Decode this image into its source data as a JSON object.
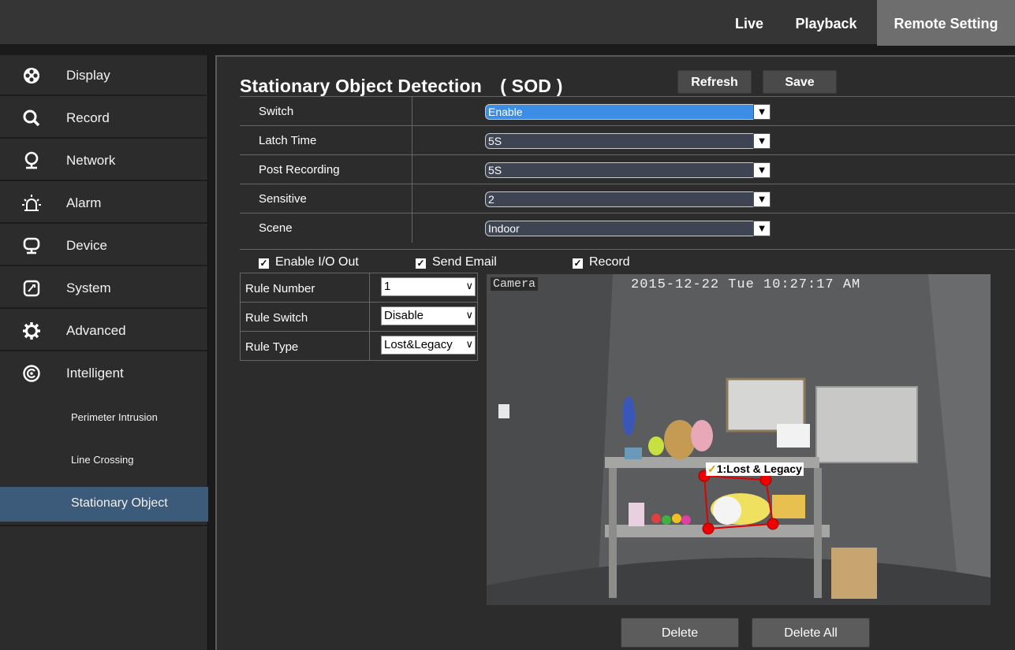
{
  "topnav": {
    "live": "Live",
    "playback": "Playback",
    "remote_setting": "Remote Setting"
  },
  "sidebar": {
    "items": [
      {
        "label": "Display",
        "icon": "display-icon"
      },
      {
        "label": "Record",
        "icon": "magnifier-icon"
      },
      {
        "label": "Network",
        "icon": "network-pin-icon"
      },
      {
        "label": "Alarm",
        "icon": "alarm-bell-icon"
      },
      {
        "label": "Device",
        "icon": "monitor-icon"
      },
      {
        "label": "System",
        "icon": "system-icon"
      },
      {
        "label": "Advanced",
        "icon": "gear-icon"
      },
      {
        "label": "Intelligent",
        "icon": "intelligent-icon"
      }
    ],
    "subitems": [
      {
        "label": "Perimeter Intrusion"
      },
      {
        "label": "Line Crossing"
      },
      {
        "label": "Stationary Object",
        "active": true
      }
    ]
  },
  "main": {
    "title": "Stationary Object Detection　( SOD )",
    "refresh_label": "Refresh",
    "save_label": "Save",
    "settings": [
      {
        "label": "Switch",
        "value": "Enable"
      },
      {
        "label": "Latch Time",
        "value": "5S"
      },
      {
        "label": "Post Recording",
        "value": "5S"
      },
      {
        "label": "Sensitive",
        "value": "2"
      },
      {
        "label": "Scene",
        "value": "Indoor"
      }
    ],
    "checkboxes": [
      {
        "label": "Enable I/O Out",
        "checked": true
      },
      {
        "label": "Send Email",
        "checked": true
      },
      {
        "label": "Record",
        "checked": true
      }
    ],
    "rules": [
      {
        "label": "Rule Number",
        "value": "1"
      },
      {
        "label": "Rule Switch",
        "value": "Disable"
      },
      {
        "label": "Rule Type",
        "value": "Lost&Legacy"
      }
    ],
    "camera": {
      "name_osd": "Camera",
      "timestamp_osd": "2015-12-22 Tue 10:27:17 AM",
      "roi_label": "1:Lost & Legacy"
    },
    "delete_label": "Delete",
    "delete_all_label": "Delete All"
  },
  "colors": {
    "active_nav": "#6e6e6e",
    "active_sub": "#3c5a7a",
    "select_highlight": "#3b8de6",
    "roi": "#e00000"
  }
}
